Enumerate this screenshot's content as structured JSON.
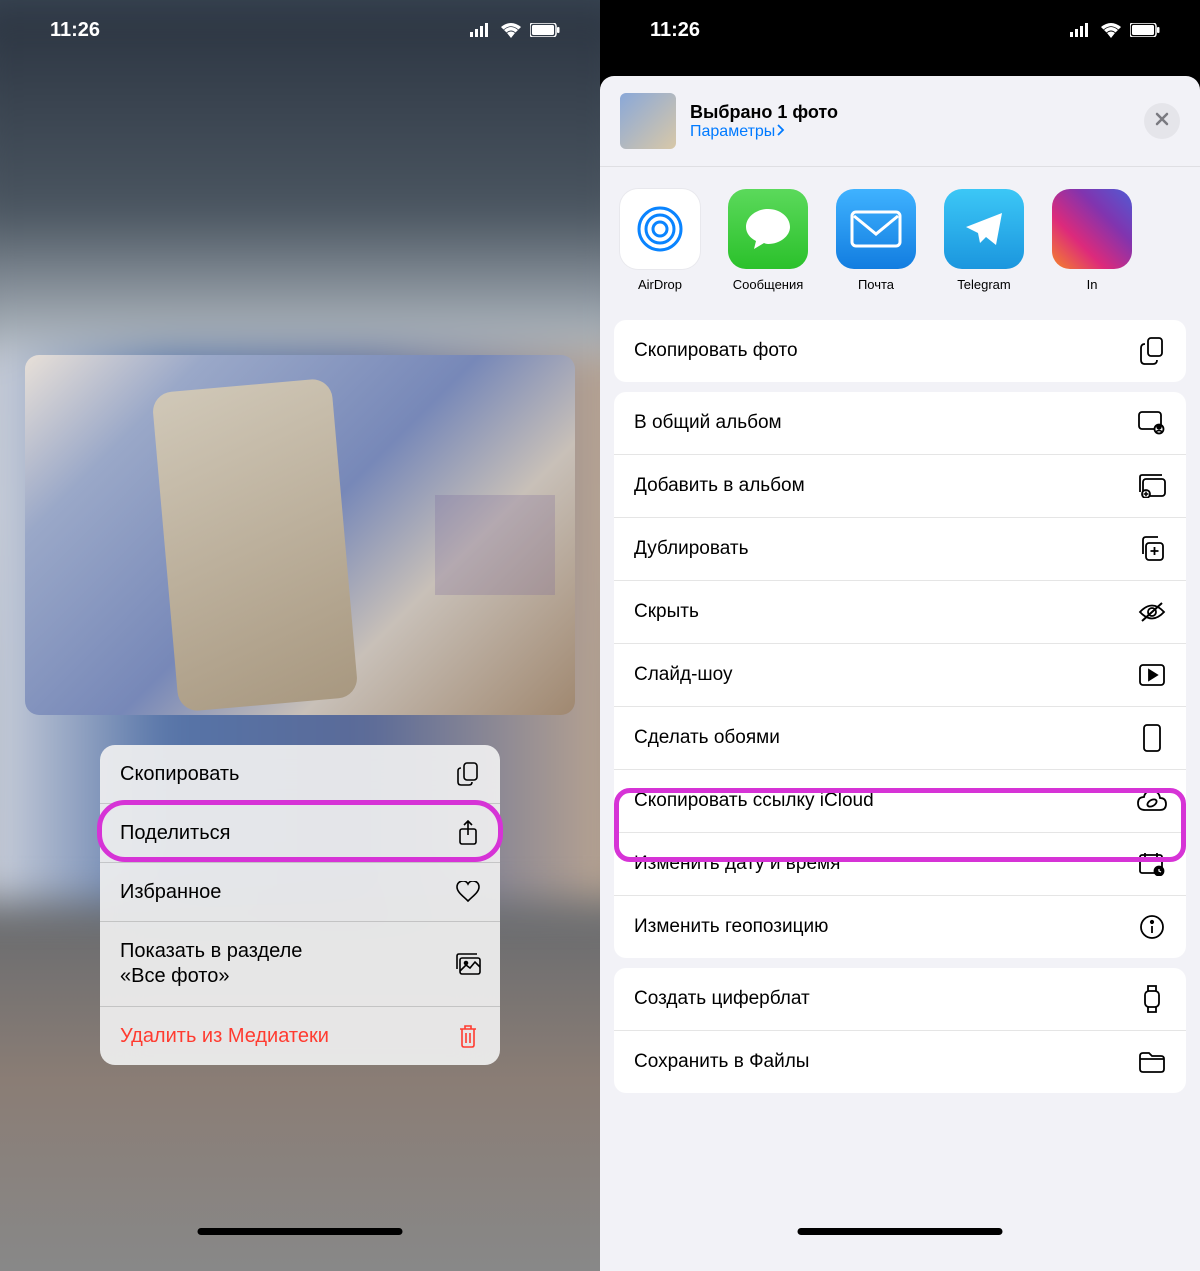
{
  "status": {
    "time": "11:26"
  },
  "left": {
    "ctx": {
      "copy": "Скопировать",
      "share": "Поделиться",
      "favorite": "Избранное",
      "show_all_line1": "Показать в разделе",
      "show_all_line2": "«Все фото»",
      "delete": "Удалить из Медиатеки"
    }
  },
  "right": {
    "header": {
      "title": "Выбрано 1 фото",
      "params": "Параметры"
    },
    "apps": {
      "airdrop": "AirDrop",
      "messages": "Сообщения",
      "mail": "Почта",
      "telegram": "Telegram",
      "instagram": "In"
    },
    "actions": {
      "copy_photo": "Скопировать фото",
      "shared_album": "В общий альбом",
      "add_album": "Добавить в альбом",
      "duplicate": "Дублировать",
      "hide": "Скрыть",
      "slideshow": "Слайд-шоу",
      "wallpaper": "Сделать обоями",
      "copy_icloud": "Скопировать ссылку iCloud",
      "date_time": "Изменить дату и время",
      "location": "Изменить геопозицию",
      "watchface": "Создать циферблат",
      "save_files": "Сохранить в Файлы"
    }
  }
}
